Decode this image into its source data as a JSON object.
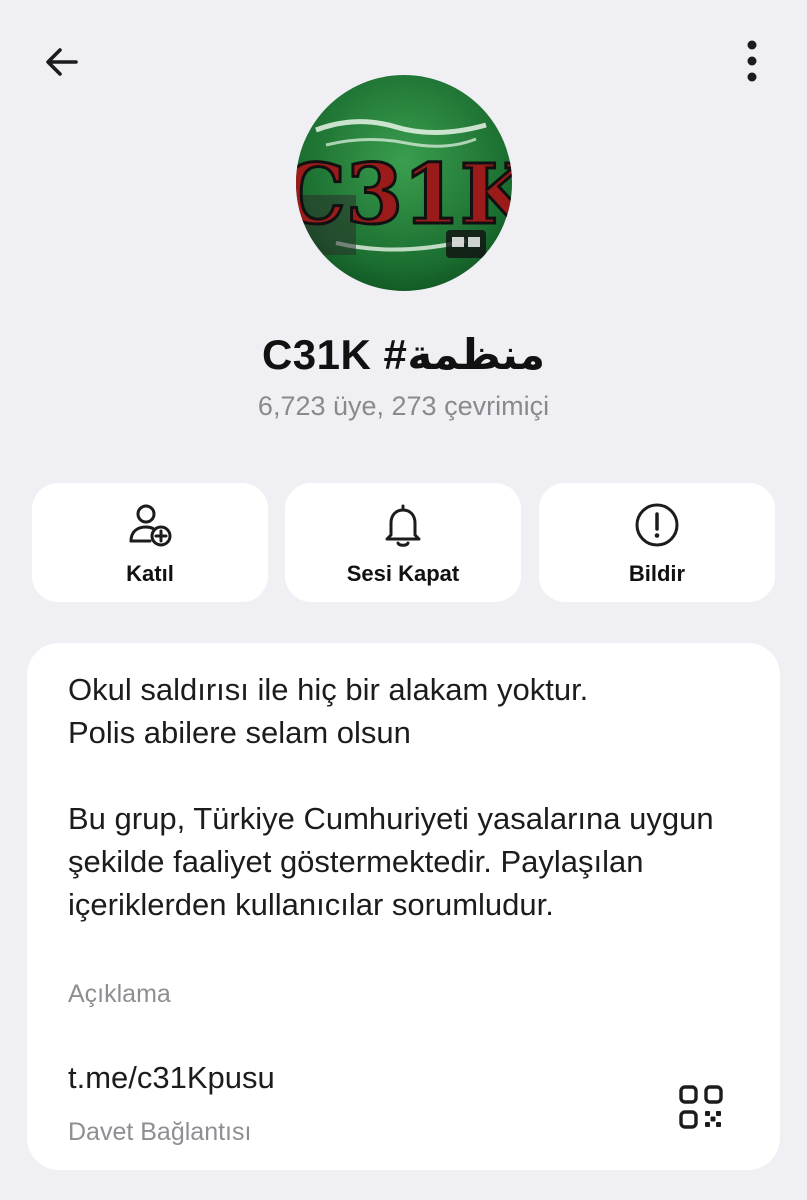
{
  "header": {
    "back_icon": "arrow-left-icon",
    "more_icon": "more-vertical-icon"
  },
  "profile": {
    "title": "C31K #منظمة",
    "subtitle": "6,723 üye, 273 çevrimiçi",
    "avatar_text": "C31K"
  },
  "actions": [
    {
      "label": "Katıl",
      "icon": "user-add-icon"
    },
    {
      "label": "Sesi Kapat",
      "icon": "bell-icon"
    },
    {
      "label": "Bildir",
      "icon": "alert-circle-icon"
    }
  ],
  "info": {
    "description": "Okul saldırısı ile hiç bir alakam yoktur.\nPolis abilere selam olsun\n\nBu grup, Türkiye Cumhuriyeti yasalarına uygun şekilde faaliyet göstermektedir. Paylaşılan içeriklerden kullanıcılar sorumludur.",
    "description_caption": "Açıklama",
    "link": "t.me/c31Kpusu",
    "link_caption": "Davet Bağlantısı"
  },
  "colors": {
    "background": "#efeff4",
    "card": "#ffffff",
    "secondary_text": "#8e8e93",
    "avatar_green": "#1e7a35"
  }
}
